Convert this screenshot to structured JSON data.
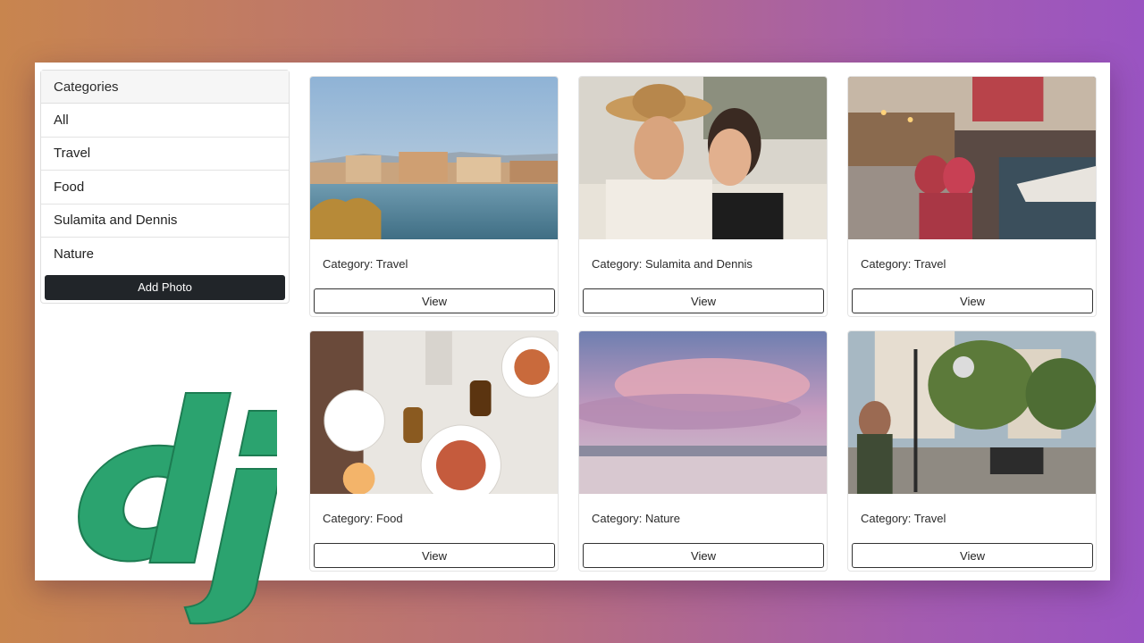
{
  "sidebar": {
    "header": "Categories",
    "items": [
      {
        "label": "All"
      },
      {
        "label": "Travel"
      },
      {
        "label": "Food"
      },
      {
        "label": "Sulamita and Dennis"
      },
      {
        "label": "Nature"
      }
    ],
    "add_button": "Add Photo"
  },
  "cards": [
    {
      "category": "Category: Travel",
      "button": "View"
    },
    {
      "category": "Category: Sulamita and Dennis",
      "button": "View"
    },
    {
      "category": "Category: Travel",
      "button": "View"
    },
    {
      "category": "Category: Food",
      "button": "View"
    },
    {
      "category": "Category: Nature",
      "button": "View"
    },
    {
      "category": "Category: Travel",
      "button": "View"
    }
  ],
  "logo": {
    "text": "dj",
    "color": "#2ba36f"
  },
  "colors": {
    "button_dark": "#212529",
    "gradient_left": "#c8854e",
    "gradient_right": "#9a54c2"
  }
}
